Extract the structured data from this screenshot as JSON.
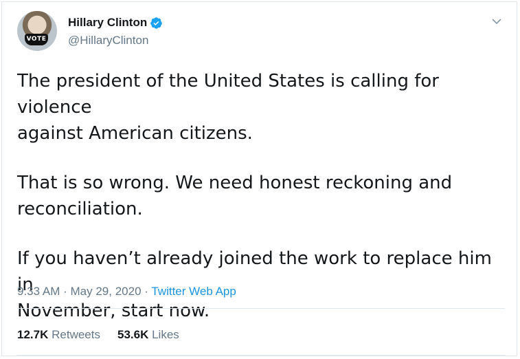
{
  "tweet": {
    "author": {
      "display_name": "Hillary Clinton",
      "handle": "@HillaryClinton",
      "verified": true,
      "avatar_mask_text": "VOTE"
    },
    "paragraphs": [
      "The president of the United States is calling for violence\nagainst American citizens.",
      "That is so wrong. We need honest reckoning and\nreconciliation.",
      "If you haven’t already joined the work to replace him in\nNovember, start now."
    ],
    "time": "9:33 AM",
    "separator": "·",
    "date": "May 29, 2020",
    "source": "Twitter Web App",
    "retweets": {
      "count": "12.7K",
      "label": "Retweets"
    },
    "likes": {
      "count": "53.6K",
      "label": "Likes"
    }
  },
  "icons": {
    "verified": "verified-badge-icon",
    "menu": "chevron-down-icon"
  },
  "colors": {
    "accent": "#1b95e0",
    "verified_badge": "#1da1f2",
    "text_primary": "#14171a",
    "text_secondary": "#657786",
    "border": "#e1e8ed"
  }
}
